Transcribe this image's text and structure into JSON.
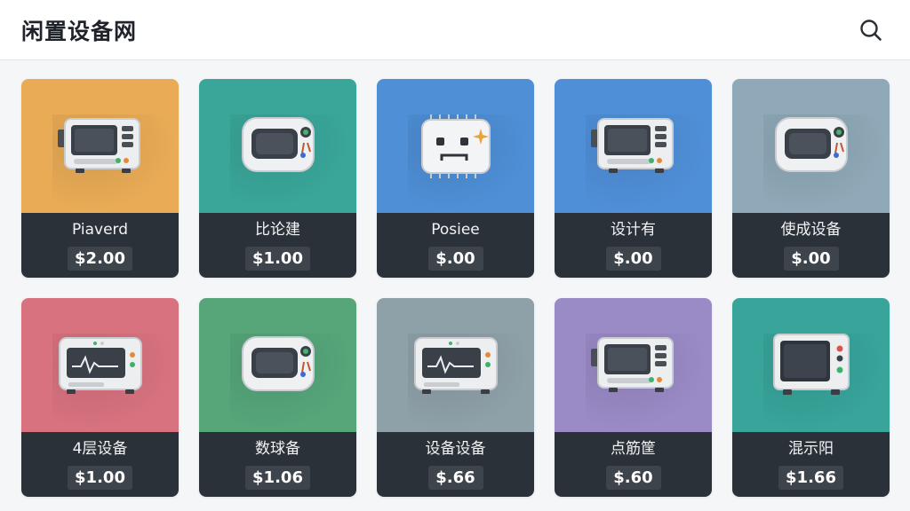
{
  "header": {
    "title": "闲置设备网",
    "search_icon": "search-icon"
  },
  "items": [
    {
      "name": "Piaverd",
      "price": "$2.00",
      "bg": "#e9ab56",
      "icon": "microwave-device-icon"
    },
    {
      "name": "比论建",
      "price": "$1.00",
      "bg": "#3aa69a",
      "icon": "monitor-device-icon"
    },
    {
      "name": "Posiee",
      "price": "$.00",
      "bg": "#4e8fd6",
      "icon": "robot-face-icon"
    },
    {
      "name": "设计有",
      "price": "$.00",
      "bg": "#4f8fd8",
      "icon": "microwave-device-icon"
    },
    {
      "name": "使成设备",
      "price": "$.00",
      "bg": "#8fa9b8",
      "icon": "monitor-device-icon"
    },
    {
      "name": "4层设备",
      "price": "$1.00",
      "bg": "#d8727f",
      "icon": "ecg-monitor-icon"
    },
    {
      "name": "数球备",
      "price": "$1.06",
      "bg": "#56a67a",
      "icon": "monitor-device-icon"
    },
    {
      "name": "设备设备",
      "price": "$.66",
      "bg": "#8ea0a8",
      "icon": "ecg-monitor-icon"
    },
    {
      "name": "点筋筐",
      "price": "$.60",
      "bg": "#9a8ac6",
      "icon": "microwave-device-icon"
    },
    {
      "name": "混示阳",
      "price": "$1.66",
      "bg": "#38a49a",
      "icon": "tv-device-icon"
    }
  ]
}
